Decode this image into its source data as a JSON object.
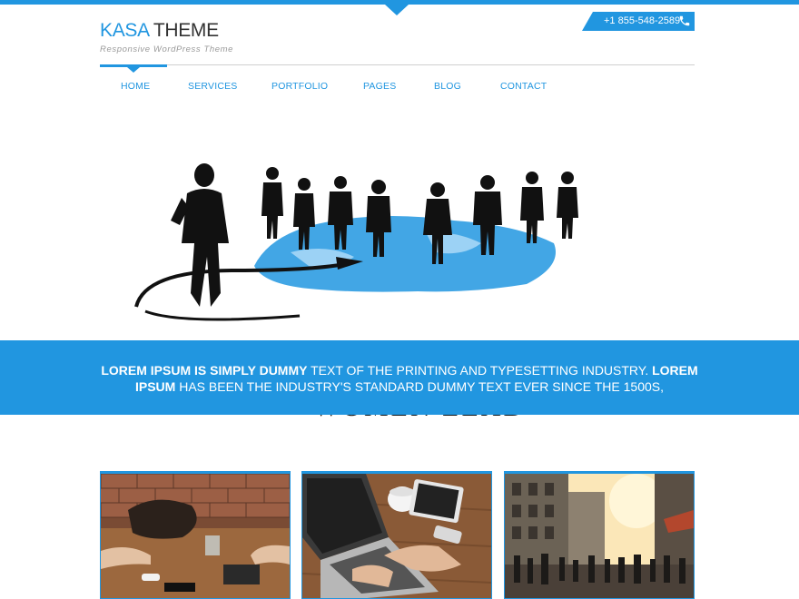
{
  "brand": {
    "title_part1": "KASA",
    "title_part2": "THEME",
    "tagline": "Responsive WordPress Theme",
    "accent_color": "#2196e0"
  },
  "contact": {
    "phone": "+1 855-548-2589",
    "icon": "phone-icon"
  },
  "nav": {
    "items": [
      {
        "label": "HOME",
        "active": true
      },
      {
        "label": "SERVICES",
        "active": false
      },
      {
        "label": "PORTFOLIO",
        "active": false
      },
      {
        "label": "PAGES",
        "active": false
      },
      {
        "label": "BLOG",
        "active": false
      },
      {
        "label": "CONTACT",
        "active": false
      }
    ]
  },
  "hero": {
    "text": "WOMEN LEAD"
  },
  "banner": {
    "bold1": "LOREM IPSUM IS SIMPLY DUMMY",
    "normal1": " TEXT OF THE PRINTING AND TYPESETTING INDUSTRY. ",
    "bold2": "LOREM IPSUM",
    "normal2": " HAS BEEN THE INDUSTRY'S STANDARD DUMMY TEXT EVER SINCE THE 1500S,"
  },
  "cards": [
    {
      "subject": "cafe-table-meeting-photo"
    },
    {
      "subject": "laptop-typing-photo"
    },
    {
      "subject": "city-street-crowd-photo"
    }
  ]
}
